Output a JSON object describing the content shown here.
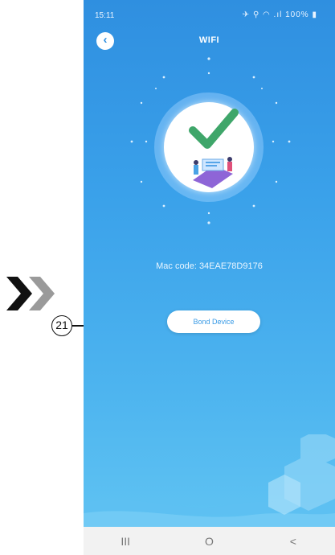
{
  "annotation": {
    "callout_number": "21"
  },
  "status_bar": {
    "time": "15:11",
    "battery": "100%",
    "icons": "✈ ⚲ ◠ .ıl"
  },
  "header": {
    "title": "WIFI",
    "back_icon": "chevron-left-icon"
  },
  "main": {
    "mac_code": "Mac code: 34EAE78D9176",
    "bond_button_label": "Bond Device"
  },
  "nav_bar": {
    "recent": "III",
    "home": "O",
    "back": "<"
  },
  "colors": {
    "accent": "#2f8fe0",
    "check_green": "#3fa66a"
  }
}
